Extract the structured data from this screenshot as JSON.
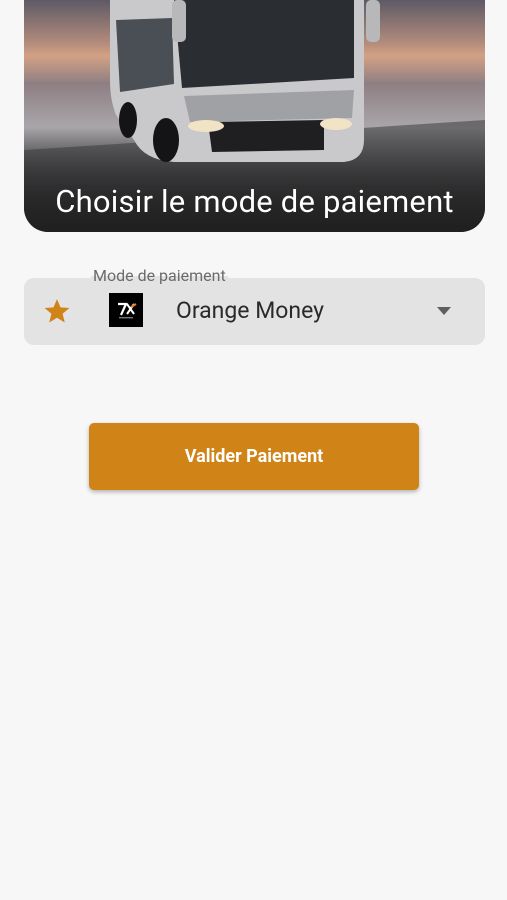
{
  "header": {
    "title": "Choisir le mode de paiement",
    "image": "bus-photo"
  },
  "payment_method": {
    "label": "Mode de paiement",
    "selected": "Orange Money",
    "leading_icon": "star-icon",
    "option_logo": "orange-money-logo",
    "trailing_icon": "dropdown-arrow-icon"
  },
  "actions": {
    "submit_label": "Valider Paiement"
  },
  "colors": {
    "accent": "#d08418",
    "background": "#f7f7f7",
    "field_background": "#e3e3e3"
  }
}
